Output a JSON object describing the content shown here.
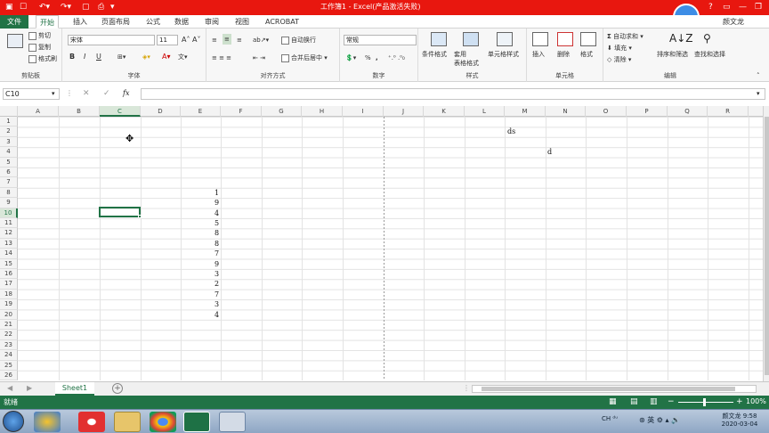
{
  "window": {
    "title": "工作簿1 - Excel(产品激活失败)",
    "timer": "00:51"
  },
  "tabs": [
    "文件",
    "开始",
    "插入",
    "页面布局",
    "公式",
    "数据",
    "审阅",
    "视图",
    "ACROBAT"
  ],
  "clipboard": {
    "cut": "剪切",
    "copy": "复制",
    "format_painter": "格式刷",
    "label": "剪贴板"
  },
  "font": {
    "name": "宋体",
    "size": "11",
    "label": "字体",
    "bold": "B",
    "italic": "I",
    "underline": "U"
  },
  "alignment": {
    "wrap": "自动换行",
    "merge": "合并后居中",
    "label": "对齐方式"
  },
  "number": {
    "format": "常规",
    "label": "数字",
    "percent": "%",
    "comma": ","
  },
  "styles": {
    "conditional": "条件格式",
    "table": "套用\n表格格式",
    "cell_styles": "单元格样式",
    "label": "样式"
  },
  "cells": {
    "insert": "插入",
    "delete": "删除",
    "format": "格式",
    "label": "单元格"
  },
  "editing": {
    "autosum": "自动求和",
    "fill": "填充",
    "clear": "清除",
    "sort": "排序和筛选",
    "find": "查找和选择",
    "label": "编辑"
  },
  "user": "颜文龙",
  "formula": {
    "namebox": "C10",
    "fx": "fx",
    "value": ""
  },
  "columns": [
    "A",
    "B",
    "C",
    "D",
    "E",
    "F",
    "G",
    "H",
    "I",
    "J",
    "K",
    "L",
    "M",
    "N",
    "O",
    "P",
    "Q",
    "R"
  ],
  "rows": [
    "1",
    "2",
    "3",
    "4",
    "5",
    "6",
    "7",
    "8",
    "9",
    "10",
    "11",
    "12",
    "13",
    "14",
    "15",
    "16",
    "17",
    "18",
    "19",
    "20",
    "21",
    "22",
    "23",
    "24",
    "25",
    "26"
  ],
  "cell_values": {
    "M2": "ds",
    "N4": "d",
    "E8": "1",
    "E9": "9",
    "E10": "4",
    "E11": "5",
    "E12": "8",
    "E13": "8",
    "E14": "7",
    "E15": "9",
    "E16": "3",
    "E17": "2",
    "E18": "7",
    "E19": "3",
    "E20": "4"
  },
  "sheet": {
    "tab": "Sheet1",
    "add": "+"
  },
  "status": {
    "ready": "就绪",
    "zoom": "100%"
  },
  "taskbar": {
    "clock_time": "9:58",
    "clock_date": "2020-03-04",
    "user": "颜文龙"
  },
  "colors": {
    "title_red": "#e8170f",
    "excel_green": "#217346"
  }
}
